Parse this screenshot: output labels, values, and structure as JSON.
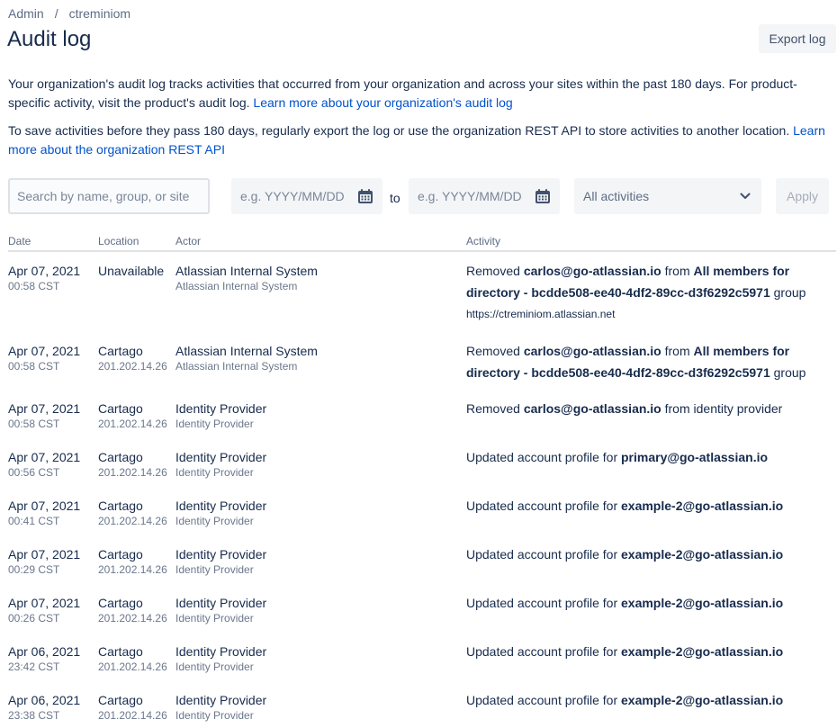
{
  "breadcrumb": {
    "root": "Admin",
    "separator": "/",
    "org": "ctreminiom"
  },
  "page_title": "Audit log",
  "export_label": "Export log",
  "description": {
    "p1_text": "Your organization's audit log tracks activities that occurred from your organization and across your sites within the past 180 days. For product-specific activity, visit the product's audit log.",
    "p1_link": "Learn more about your organization's audit log",
    "p2_text": "To save activities before they pass 180 days, regularly export the log or use the organization REST API to store activities to another location.",
    "p2_link": "Learn more about the organization REST API"
  },
  "filters": {
    "search_placeholder": "Search by name, group, or site",
    "date_from_placeholder": "e.g. YYYY/MM/DD",
    "to_label": "to",
    "date_to_placeholder": "e.g. YYYY/MM/DD",
    "activity_select": "All activities",
    "apply_label": "Apply"
  },
  "columns": {
    "date": "Date",
    "location": "Location",
    "actor": "Actor",
    "activity": "Activity"
  },
  "rows": [
    {
      "date": "Apr 07, 2021",
      "time": "00:58 CST",
      "location": "Unavailable",
      "ip": "",
      "actor": "Atlassian Internal System",
      "actor_sub": "Atlassian Internal System",
      "a_pre": "Removed ",
      "a_b1": "carlos@go-atlassian.io",
      "a_mid": " from ",
      "a_b2": "All members for directory - bcdde508-ee40-4df2-89cc-d3f6292c5971",
      "a_post": " group",
      "a_url": "https://ctreminiom.atlassian.net"
    },
    {
      "date": "Apr 07, 2021",
      "time": "00:58 CST",
      "location": "Cartago",
      "ip": "201.202.14.26",
      "actor": "Atlassian Internal System",
      "actor_sub": "Atlassian Internal System",
      "a_pre": "Removed ",
      "a_b1": "carlos@go-atlassian.io",
      "a_mid": " from ",
      "a_b2": "All members for directory - bcdde508-ee40-4df2-89cc-d3f6292c5971",
      "a_post": " group",
      "a_url": ""
    },
    {
      "date": "Apr 07, 2021",
      "time": "00:58 CST",
      "location": "Cartago",
      "ip": "201.202.14.26",
      "actor": "Identity Provider",
      "actor_sub": "Identity Provider",
      "a_pre": "Removed ",
      "a_b1": "carlos@go-atlassian.io",
      "a_mid": " from identity provider",
      "a_b2": "",
      "a_post": "",
      "a_url": ""
    },
    {
      "date": "Apr 07, 2021",
      "time": "00:56 CST",
      "location": "Cartago",
      "ip": "201.202.14.26",
      "actor": "Identity Provider",
      "actor_sub": "Identity Provider",
      "a_pre": "Updated account profile for ",
      "a_b1": "primary@go-atlassian.io",
      "a_mid": "",
      "a_b2": "",
      "a_post": "",
      "a_url": ""
    },
    {
      "date": "Apr 07, 2021",
      "time": "00:41 CST",
      "location": "Cartago",
      "ip": "201.202.14.26",
      "actor": "Identity Provider",
      "actor_sub": "Identity Provider",
      "a_pre": "Updated account profile for ",
      "a_b1": "example-2@go-atlassian.io",
      "a_mid": "",
      "a_b2": "",
      "a_post": "",
      "a_url": ""
    },
    {
      "date": "Apr 07, 2021",
      "time": "00:29 CST",
      "location": "Cartago",
      "ip": "201.202.14.26",
      "actor": "Identity Provider",
      "actor_sub": "Identity Provider",
      "a_pre": "Updated account profile for ",
      "a_b1": "example-2@go-atlassian.io",
      "a_mid": "",
      "a_b2": "",
      "a_post": "",
      "a_url": ""
    },
    {
      "date": "Apr 07, 2021",
      "time": "00:26 CST",
      "location": "Cartago",
      "ip": "201.202.14.26",
      "actor": "Identity Provider",
      "actor_sub": "Identity Provider",
      "a_pre": "Updated account profile for ",
      "a_b1": "example-2@go-atlassian.io",
      "a_mid": "",
      "a_b2": "",
      "a_post": "",
      "a_url": ""
    },
    {
      "date": "Apr 06, 2021",
      "time": "23:42 CST",
      "location": "Cartago",
      "ip": "201.202.14.26",
      "actor": "Identity Provider",
      "actor_sub": "Identity Provider",
      "a_pre": "Updated account profile for ",
      "a_b1": "example-2@go-atlassian.io",
      "a_mid": "",
      "a_b2": "",
      "a_post": "",
      "a_url": ""
    },
    {
      "date": "Apr 06, 2021",
      "time": "23:38 CST",
      "location": "Cartago",
      "ip": "201.202.14.26",
      "actor": "Identity Provider",
      "actor_sub": "Identity Provider",
      "a_pre": "Updated account profile for ",
      "a_b1": "example-2@go-atlassian.io",
      "a_mid": "",
      "a_b2": "",
      "a_post": "",
      "a_url": ""
    }
  ]
}
